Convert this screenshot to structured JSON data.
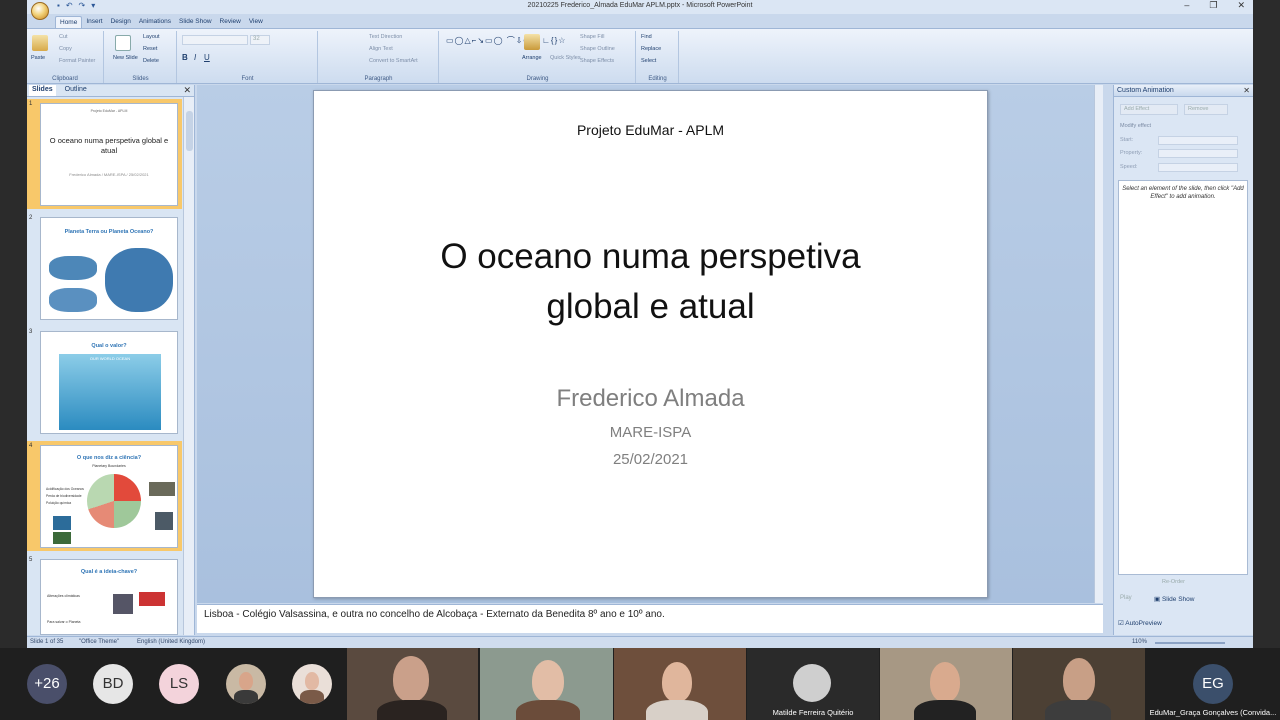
{
  "window": {
    "title": "20210225 Frederico_Almada EduMar APLM.pptx - Microsoft PowerPoint",
    "controls": [
      "–",
      "❐",
      "✕"
    ]
  },
  "ribbon": {
    "tabs": [
      "Home",
      "Insert",
      "Design",
      "Animations",
      "Slide Show",
      "Review",
      "View"
    ],
    "active_tab": "Home",
    "groups": {
      "clipboard": {
        "label": "Clipboard",
        "paste": "Paste",
        "cut": "Cut",
        "copy": "Copy",
        "format_painter": "Format Painter"
      },
      "slides": {
        "label": "Slides",
        "new_slide": "New Slide",
        "layout": "Layout",
        "reset": "Reset",
        "delete": "Delete"
      },
      "font": {
        "label": "Font",
        "size": "32"
      },
      "paragraph": {
        "label": "Paragraph",
        "text_direction": "Text Direction",
        "align_text": "Align Text",
        "smartart": "Convert to SmartArt"
      },
      "drawing": {
        "label": "Drawing",
        "arrange": "Arrange",
        "quick_styles": "Quick Styles",
        "shape_fill": "Shape Fill",
        "shape_outline": "Shape Outline",
        "shape_effects": "Shape Effects"
      },
      "editing": {
        "label": "Editing",
        "find": "Find",
        "replace": "Replace",
        "select": "Select"
      }
    }
  },
  "slides_panel": {
    "tabs": [
      "Slides",
      "Outline"
    ],
    "thumbnails": [
      {
        "number": "1",
        "header": "Projeto EduMar - APLM",
        "title": "O oceano numa perspetiva global e atual",
        "sub": "Frederico Almada / MARE-ISPA / 25/02/2021"
      },
      {
        "number": "2",
        "title": "Planeta Terra ou Planeta Oceano?"
      },
      {
        "number": "3",
        "title": "Qual o valor?",
        "subtitle": "OUR WORLD OCEAN"
      },
      {
        "number": "4",
        "title": "O que nos diz a ciência?",
        "subtitle": "Planetary Boundaries",
        "bullets": [
          "Acidificação dos Oceanos",
          "Perda de biodiversidade",
          "Poluição química"
        ]
      },
      {
        "number": "5",
        "title": "Qual é a ideia-chave?",
        "bullets": [
          "Alterações climáticas",
          "Para salvar o Planeta"
        ]
      }
    ]
  },
  "slide": {
    "header": "Projeto EduMar - APLM",
    "title_line1": "O oceano numa perspetiva",
    "title_line2": "global e atual",
    "author": "Frederico Almada",
    "institution": "MARE-ISPA",
    "date": "25/02/2021"
  },
  "notes_text": "Lisboa - Colégio Valsassina, e outra no concelho de Alcobaça - Externato da Benedita 8º ano e 10º ano.",
  "animation_pane": {
    "title": "Custom Animation",
    "add_effect": "Add Effect",
    "remove": "Remove",
    "modify_label": "Modify effect",
    "fields": [
      "Start:",
      "Property:",
      "Speed:"
    ],
    "hint": "Select an element of the slide, then click \"Add Effect\" to add animation.",
    "reorder": "Re-Order",
    "play": "Play",
    "slide_show": "Slide Show",
    "autopreview": "AutoPreview"
  },
  "statusbar": {
    "slide": "Slide 1 of 35",
    "theme": "\"Office Theme\"",
    "language": "English (United Kingdom)",
    "zoom": "110%"
  },
  "participants": {
    "more_count": "+26",
    "initials": [
      "BD",
      "LS",
      "EG"
    ],
    "names": [
      "Matilde Ferreira Quitério",
      "EduMar_Graça Gonçalves (Convida..."
    ]
  },
  "colors": {
    "accent": "#2e74b5",
    "avatar_more": "#4a4f6a",
    "avatar_bd": "#e6e6e6",
    "avatar_ls": "#f3d3db",
    "avatar_eg": "#3b4f6b"
  }
}
